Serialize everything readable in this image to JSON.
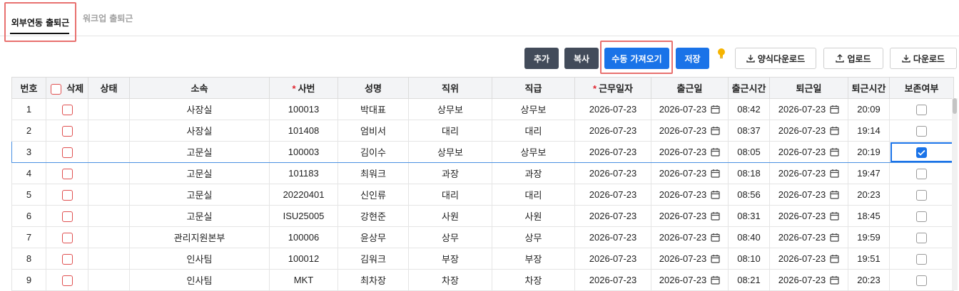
{
  "tabs": [
    {
      "label": "외부연동 출퇴근",
      "active": true
    },
    {
      "label": "워크업 출퇴근",
      "active": false
    }
  ],
  "toolbar": {
    "add": "추가",
    "copy": "복사",
    "manual_fetch": "수동 가져오기",
    "save": "저장",
    "template_download": "양식다운로드",
    "upload": "업로드",
    "download": "다운로드"
  },
  "colors": {
    "dark_button": "#424b5a",
    "primary": "#1a73e8",
    "highlight": "#e8716f",
    "required": "#e0242e"
  },
  "table": {
    "headers": {
      "no": "번호",
      "delete": "삭제",
      "status": "상태",
      "dept": "소속",
      "emp_no": "사번",
      "name": "성명",
      "position": "직위",
      "grade": "직급",
      "work_date": "근무일자",
      "in_date": "출근일",
      "in_time": "출근시간",
      "out_date": "퇴근일",
      "out_time": "퇴근시간",
      "keep": "보존여부"
    },
    "required_mark": "*",
    "rows": [
      {
        "no": "1",
        "status": "",
        "dept": "사장실",
        "emp_no": "100013",
        "name": "박대표",
        "position": "상무보",
        "grade": "상무보",
        "work_date": "2026-07-23",
        "in_date": "2026-07-23",
        "in_time": "08:42",
        "out_date": "2026-07-23",
        "out_time": "20:09",
        "keep": false
      },
      {
        "no": "2",
        "status": "",
        "dept": "사장실",
        "emp_no": "101408",
        "name": "엄비서",
        "position": "대리",
        "grade": "대리",
        "work_date": "2026-07-23",
        "in_date": "2026-07-23",
        "in_time": "08:37",
        "out_date": "2026-07-23",
        "out_time": "19:14",
        "keep": false
      },
      {
        "no": "3",
        "status": "",
        "dept": "고문실",
        "emp_no": "100003",
        "name": "김이수",
        "position": "상무보",
        "grade": "상무보",
        "work_date": "2026-07-23",
        "in_date": "2026-07-23",
        "in_time": "08:05",
        "out_date": "2026-07-23",
        "out_time": "20:19",
        "keep": true
      },
      {
        "no": "4",
        "status": "",
        "dept": "고문실",
        "emp_no": "101183",
        "name": "최워크",
        "position": "과장",
        "grade": "과장",
        "work_date": "2026-07-23",
        "in_date": "2026-07-23",
        "in_time": "08:18",
        "out_date": "2026-07-23",
        "out_time": "19:47",
        "keep": false
      },
      {
        "no": "5",
        "status": "",
        "dept": "고문실",
        "emp_no": "20220401",
        "name": "신인류",
        "position": "대리",
        "grade": "대리",
        "work_date": "2026-07-23",
        "in_date": "2026-07-23",
        "in_time": "08:56",
        "out_date": "2026-07-23",
        "out_time": "20:23",
        "keep": false
      },
      {
        "no": "6",
        "status": "",
        "dept": "고문실",
        "emp_no": "ISU25005",
        "name": "강현준",
        "position": "사원",
        "grade": "사원",
        "work_date": "2026-07-23",
        "in_date": "2026-07-23",
        "in_time": "08:31",
        "out_date": "2026-07-23",
        "out_time": "18:45",
        "keep": false
      },
      {
        "no": "7",
        "status": "",
        "dept": "관리지원본부",
        "emp_no": "100006",
        "name": "윤상무",
        "position": "상무",
        "grade": "상무",
        "work_date": "2026-07-23",
        "in_date": "2026-07-23",
        "in_time": "08:40",
        "out_date": "2026-07-23",
        "out_time": "19:59",
        "keep": false
      },
      {
        "no": "8",
        "status": "",
        "dept": "인사팀",
        "emp_no": "100012",
        "name": "김워크",
        "position": "부장",
        "grade": "부장",
        "work_date": "2026-07-23",
        "in_date": "2026-07-23",
        "in_time": "08:10",
        "out_date": "2026-07-23",
        "out_time": "19:51",
        "keep": false
      },
      {
        "no": "9",
        "status": "",
        "dept": "인사팀",
        "emp_no": "MKT",
        "name": "최차장",
        "position": "차장",
        "grade": "차장",
        "work_date": "2026-07-23",
        "in_date": "2026-07-23",
        "in_time": "08:21",
        "out_date": "2026-07-23",
        "out_time": "20:23",
        "keep": false
      }
    ]
  }
}
